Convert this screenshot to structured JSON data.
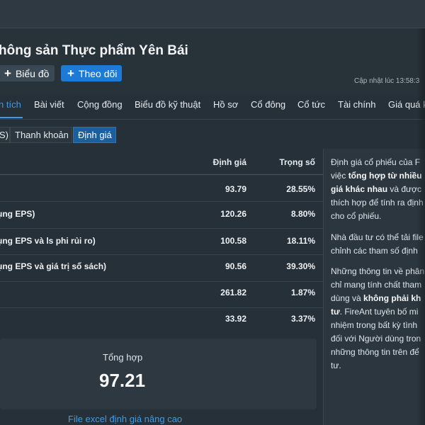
{
  "header": {
    "company_title": "hông sản Thực phẩm Yên Bái",
    "chart_button": "Biểu đồ",
    "follow_button": "Theo dõi",
    "updated": "Cập nhật lúc  13:58:3"
  },
  "nav": {
    "items": [
      "n tích",
      "Bài viết",
      "Cộng đồng",
      "Biểu đồ kỹ thuật",
      "Hồ sơ",
      "Cổ đông",
      "Cổ tức",
      "Tài chính",
      "Giá quá k"
    ]
  },
  "subtabs": {
    "partial": "S)",
    "liquidity": "Thanh khoản",
    "valuation": "Định giá"
  },
  "table": {
    "col_valuation": "Định giá",
    "col_weight": "Trọng số",
    "rows": [
      {
        "label": "",
        "value": "93.79",
        "weight": "28.55%"
      },
      {
        "label": "ụng EPS)",
        "value": "120.26",
        "weight": "8.80%"
      },
      {
        "label": "ụng EPS và ls phi rủi ro)",
        "value": "100.58",
        "weight": "18.11%"
      },
      {
        "label": "ụng EPS và giá trị sổ sách)",
        "value": "90.56",
        "weight": "39.30%"
      },
      {
        "label": "",
        "value": "261.82",
        "weight": "1.87%"
      },
      {
        "label": "",
        "value": "33.92",
        "weight": "3.37%"
      }
    ]
  },
  "summary": {
    "label": "Tổng hợp",
    "value": "97.21"
  },
  "excel_link": "File excel định giá nâng cao",
  "info": {
    "p1_l1": "Định giá cổ phiếu của F",
    "p1_l2a": "việc ",
    "p1_l2b": "tổng hợp từ nhiều",
    "p1_l3a": "giá khác nhau",
    "p1_l3b": " và được",
    "p1_l4": "thích hợp để tính ra định",
    "p1_l5": "cho cổ phiếu.",
    "p2_l1": "Nhà đầu tư có thể tải file",
    "p2_l2": "chỉnh các tham số định",
    "p3_l1": "Những thông tin về phân",
    "p3_l2": "chỉ mang tính chất tham",
    "p3_l3a": "dùng và ",
    "p3_l3b": "không phải kh",
    "p3_l4a": "tư",
    "p3_l4b": ". FireAnt tuyên bố mi",
    "p3_l5": "nhiệm trong bất kỳ tình",
    "p3_l6": "đối với Người dùng tron",
    "p3_l7": "những thông tin trên để",
    "p3_l8": "tư."
  }
}
